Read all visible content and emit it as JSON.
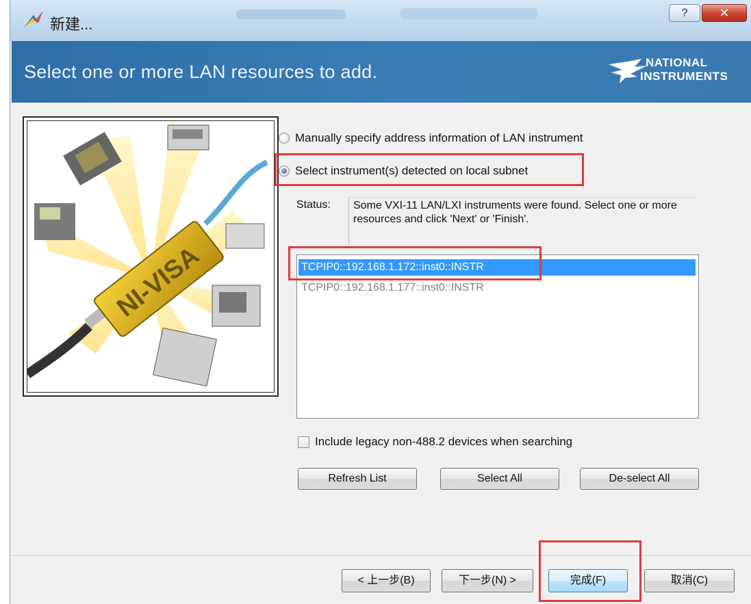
{
  "window": {
    "title": "新建..."
  },
  "header": {
    "title": "Select one or more LAN resources to add.",
    "logo_line1": "NATIONAL",
    "logo_line2": "INSTRUMENTS",
    "band_color": "#3575ad"
  },
  "illustration": {
    "product_text": "NI-VISA"
  },
  "options": {
    "manual": {
      "label": "Manually specify address information of LAN instrument",
      "checked": false
    },
    "detected": {
      "label": "Select instrument(s) detected on local subnet",
      "checked": true
    }
  },
  "status": {
    "label": "Status:",
    "message": "Some VXI-11 LAN/LXI instruments were found. Select one or more resources and click 'Next' or 'Finish'."
  },
  "resources": [
    {
      "name": "TCPIP0::192.168.1.172::inst0::INSTR",
      "selected": true
    },
    {
      "name": "TCPIP0::192.168.1.177::inst0::INSTR",
      "selected": false
    }
  ],
  "legacy_option": {
    "label": "Include legacy non-488.2 devices when searching",
    "checked": false
  },
  "list_buttons": {
    "refresh": "Refresh List",
    "select_all": "Select All",
    "deselect_all": "De-select All"
  },
  "footer": {
    "back": "< 上一步(B)",
    "next": "下一步(N) >",
    "finish": "完成(F)",
    "cancel": "取消(C)"
  },
  "highlight_color": "#e03a3a",
  "selection_color": "#3399ff"
}
